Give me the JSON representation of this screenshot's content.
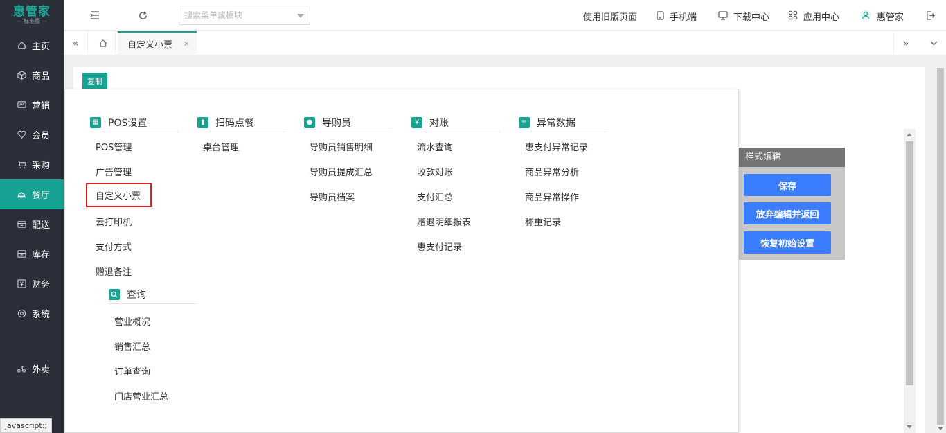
{
  "sidebar": {
    "logo_main": "惠管家",
    "logo_sub": "— 标准版 —",
    "items": [
      {
        "label": "主页",
        "icon": "home-icon"
      },
      {
        "label": "商品",
        "icon": "cube-icon"
      },
      {
        "label": "营销",
        "icon": "chart-icon"
      },
      {
        "label": "会员",
        "icon": "heart-icon"
      },
      {
        "label": "采购",
        "icon": "cart-icon"
      },
      {
        "label": "餐厅",
        "icon": "cloche-icon"
      },
      {
        "label": "配送",
        "icon": "delivery-icon"
      },
      {
        "label": "库存",
        "icon": "box-icon"
      },
      {
        "label": "财务",
        "icon": "money-icon"
      },
      {
        "label": "系统",
        "icon": "gear-icon"
      },
      {
        "label": "外卖",
        "icon": "scooter-icon"
      }
    ],
    "active_index": 5
  },
  "header": {
    "search_placeholder": "搜索菜单或模块",
    "links": [
      {
        "label": "使用旧版页面",
        "icon": ""
      },
      {
        "label": "手机端",
        "icon": "phone-icon"
      },
      {
        "label": "下载中心",
        "icon": "monitor-icon"
      },
      {
        "label": "应用中心",
        "icon": "apps-icon"
      },
      {
        "label": "惠管家",
        "icon": "user-icon"
      }
    ]
  },
  "tabs": [
    {
      "label": "自定义小票",
      "active": true
    }
  ],
  "content": {
    "copy_label": "复制",
    "style_panel": {
      "title": "样式编辑",
      "buttons": [
        "保存",
        "放弃编辑并返回",
        "恢复初始设置"
      ]
    }
  },
  "mega_menu": {
    "columns": [
      {
        "title": "POS设置",
        "icon": "pos-icon",
        "items": [
          "POS管理",
          "广告管理",
          "自定义小票",
          "云打印机",
          "支付方式",
          "赠退备注"
        ]
      },
      {
        "title": "扫码点餐",
        "icon": "mobile-icon",
        "items": [
          "桌台管理"
        ]
      },
      {
        "title": "导购员",
        "icon": "person-icon",
        "items": [
          "导购员销售明细",
          "导购员提成汇总",
          "导购员档案"
        ]
      },
      {
        "title": "对账",
        "icon": "ledger-icon",
        "items": [
          "流水查询",
          "收款对账",
          "支付汇总",
          "赠退明细报表",
          "惠支付记录"
        ]
      },
      {
        "title": "异常数据",
        "icon": "database-icon",
        "items": [
          "惠支付异常记录",
          "商品异常分析",
          "商品异常操作",
          "称重记录"
        ]
      }
    ],
    "query": {
      "title": "查询",
      "icon": "search-icon",
      "items": [
        "营业概况",
        "销售汇总",
        "订单查询",
        "门店营业汇总"
      ]
    },
    "highlighted_item": "自定义小票"
  },
  "status_bar": "javascript:;",
  "accent_color": "#17a393"
}
